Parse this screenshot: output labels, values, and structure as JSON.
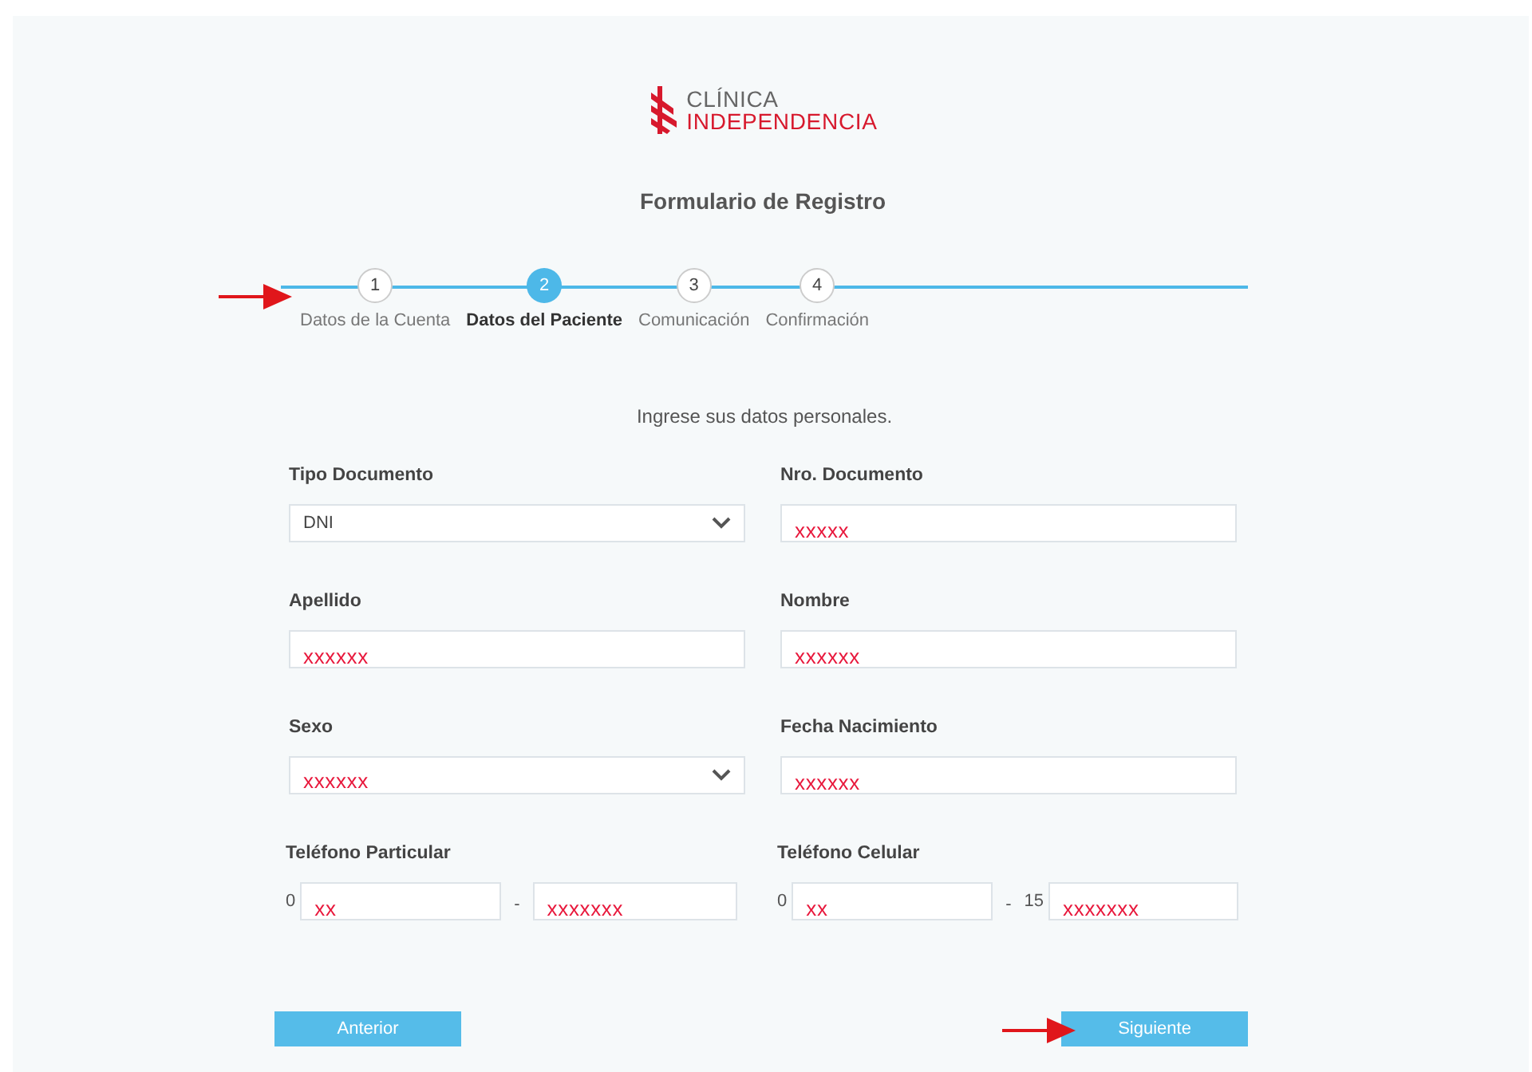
{
  "logo": {
    "line_1": "CLÍNICA",
    "line_2": "INDEPENDENCIA"
  },
  "title": "Formulario de Registro",
  "steps": [
    {
      "number": "1",
      "label": "Datos de la Cuenta",
      "selected": false
    },
    {
      "number": "2",
      "label": "Datos del Paciente",
      "selected": true
    },
    {
      "number": "3",
      "label": "Comunicación",
      "selected": false
    },
    {
      "number": "4",
      "label": "Confirmación",
      "selected": false
    }
  ],
  "intro": "Ingrese sus datos personales.",
  "fields": [
    {
      "label": "Tipo Documento",
      "kind": "select",
      "value": "DNI",
      "redacted": false
    },
    {
      "label": "Nro. Documento",
      "kind": "text",
      "value": "xxxxx",
      "redacted": true
    },
    {
      "label": "Apellido",
      "kind": "text",
      "value": "xxxxxx",
      "redacted": true
    },
    {
      "label": "Nombre",
      "kind": "text",
      "value": "xxxxxx",
      "redacted": true
    },
    {
      "label": "Sexo",
      "kind": "select",
      "value": "xxxxxx",
      "redacted": true
    },
    {
      "label": "Fecha Nacimiento",
      "kind": "text",
      "value": "xxxxxx",
      "redacted": true
    }
  ],
  "phones": [
    {
      "label": "Teléfono Particular",
      "prefix": "0",
      "area": "xx",
      "separator": "-",
      "number": "xxxxxxx"
    },
    {
      "label": "Teléfono Celular",
      "prefix": "0",
      "area": "xx",
      "separator": "-",
      "mid": "15",
      "number": "xxxxxxx"
    }
  ],
  "buttons": {
    "back": "Anterior",
    "next": "Siguiente"
  }
}
